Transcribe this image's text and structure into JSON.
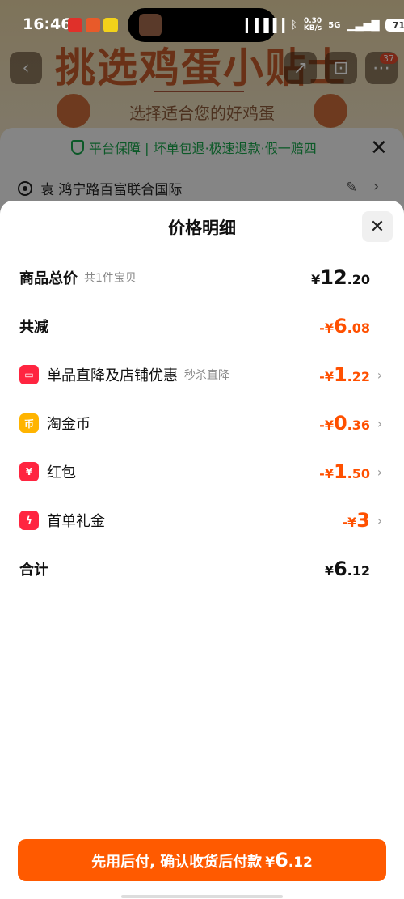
{
  "status_bar": {
    "time": "16:46",
    "speed_value": "0.30",
    "speed_unit": "KB/s",
    "network": "5G",
    "battery": "71",
    "signal_text": "ᛒ𝟖l"
  },
  "background": {
    "banner_title": "挑选鸡蛋小贴士",
    "banner_subtitle": "选择适合您的好鸡蛋",
    "cart_badge": "37",
    "guarantee_text": "平台保障 | 坏单包退·极速退款·假一赔四",
    "address": "袁 鸿宁路百富联合国际"
  },
  "sheet": {
    "title": "价格明细",
    "rows": [
      {
        "label": "商品总价",
        "sub": "共1件宝贝",
        "currency": "¥",
        "int": "12",
        "dec": ".20",
        "tone": "black"
      },
      {
        "label": "共减",
        "sub": "",
        "currency": "-¥",
        "int": "6",
        "dec": ".08",
        "tone": "orange"
      },
      {
        "label": "单品直降及店铺优惠",
        "sub": "秒杀直降",
        "currency": "-¥",
        "int": "1",
        "dec": ".22",
        "tone": "orange",
        "icon": "store-icon"
      },
      {
        "label": "淘金币",
        "sub": "",
        "currency": "-¥",
        "int": "0",
        "dec": ".36",
        "tone": "orange",
        "icon": "coin-icon"
      },
      {
        "label": "红包",
        "sub": "",
        "currency": "-¥",
        "int": "1",
        "dec": ".50",
        "tone": "orange",
        "icon": "red-packet-icon"
      },
      {
        "label": "首单礼金",
        "sub": "",
        "currency": "-¥",
        "int": "3",
        "dec": "",
        "tone": "orange",
        "icon": "lightning-icon"
      },
      {
        "label": "合计",
        "sub": "",
        "currency": "¥",
        "int": "6",
        "dec": ".12",
        "tone": "black"
      }
    ]
  },
  "pay_button": {
    "text": "先用后付, 确认收货后付款",
    "currency": "¥",
    "int": "6",
    "dec": ".12"
  },
  "colors": {
    "accent": "#ff5000",
    "button": "#ff5a00",
    "guarantee": "#17a34a",
    "icon_red": "#ff2540",
    "icon_gold": "#ffb400"
  }
}
